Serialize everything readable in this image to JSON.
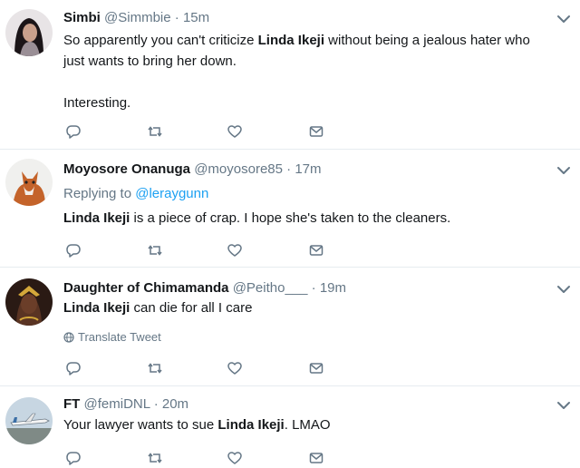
{
  "tweets": [
    {
      "name": "Simbi",
      "handle": "@Simmbie",
      "sep": "·",
      "time": "15m",
      "lines": [
        [
          {
            "t": "So apparently you can't criticize "
          },
          {
            "t": "Linda Ikeji",
            "b": true
          },
          {
            "t": " without being a jealous hater who"
          }
        ],
        [
          {
            "t": "just wants to bring her down."
          }
        ],
        [
          {
            "t": ""
          }
        ],
        [
          {
            "t": "Interesting."
          }
        ]
      ],
      "avatar_icon": "woman-avatar-dark-hair"
    },
    {
      "name": "Moyosore Onanuga",
      "handle": "@moyosore85",
      "sep": "·",
      "time": "17m",
      "replying_prefix": "Replying to",
      "replying_to": "@leraygunn",
      "lines": [
        [
          {
            "t": "Linda Ikeji",
            "b": true
          },
          {
            "t": " is a piece of crap. I hope she's taken to the cleaners."
          }
        ]
      ],
      "avatar_icon": "fox-avatar"
    },
    {
      "name": "Daughter of Chimamanda",
      "handle": "@Peitho___",
      "sep": "·",
      "time": "19m",
      "lines": [
        [
          {
            "t": "Linda Ikeji",
            "b": true
          },
          {
            "t": " can die for all I care"
          }
        ]
      ],
      "translate_label": "Translate Tweet",
      "avatar_icon": "woman-avatar-gold-headpiece"
    },
    {
      "name": "FT",
      "handle": "@femiDNL",
      "sep": "·",
      "time": "20m",
      "lines": [
        [
          {
            "t": "Your lawyer wants to sue "
          },
          {
            "t": "Linda Ikeji",
            "b": true
          },
          {
            "t": ". LMAO"
          }
        ]
      ],
      "avatar_icon": "airplane-avatar"
    }
  ],
  "colors": {
    "text": "#14171a",
    "muted": "#657786",
    "link": "#1da1f2",
    "divider": "#e6ecf0"
  },
  "action_icons": [
    "reply-icon",
    "retweet-icon",
    "like-icon",
    "direct-message-icon"
  ]
}
